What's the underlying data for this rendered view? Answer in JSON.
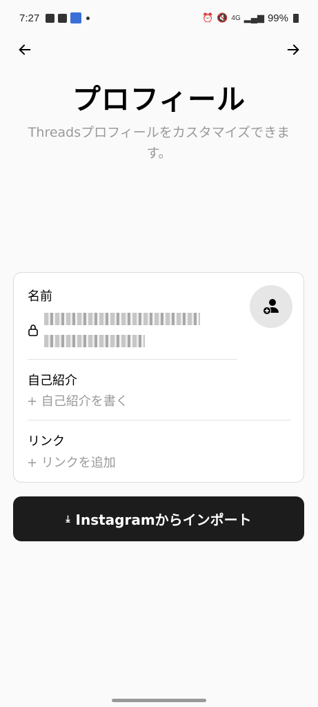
{
  "status_bar": {
    "time": "7:27",
    "network": "4G",
    "battery": "99%"
  },
  "nav": {
    "back_icon": "arrow-left-icon",
    "next_icon": "arrow-right-icon"
  },
  "header": {
    "title": "プロフィール",
    "subtitle": "Threadsプロフィールをカスタマイズできます。"
  },
  "profile_card": {
    "name_label": "名前",
    "bio_label": "自己紹介",
    "bio_placeholder": "+ 自己紹介を書く",
    "link_label": "リンク",
    "link_placeholder": "+ リンクを追加"
  },
  "import_button": {
    "label": "Instagramからインポート",
    "icon": "download-icon"
  }
}
